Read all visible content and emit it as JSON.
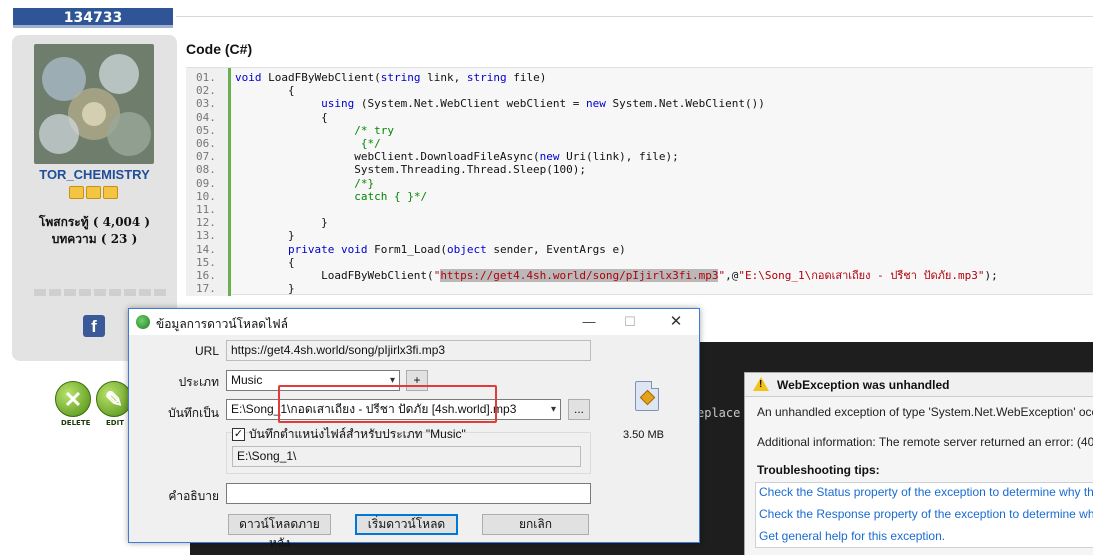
{
  "forum": {
    "post_id": "134733",
    "username": "TOR_CHEMISTRY",
    "posts_label": "โพสกระทู้ ( 4,004 )",
    "articles_label": "บทความ ( 23 )",
    "facebook_glyph": "f",
    "delete_label": "DELETE",
    "edit_label": "EDIT",
    "code_title": "Code (C#)"
  },
  "code": {
    "lines": [
      {
        "n": "01.",
        "parts": [
          {
            "t": "void",
            "c": "kw"
          },
          {
            "t": " LoadFByWebClient("
          },
          {
            "t": "string",
            "c": "kw"
          },
          {
            "t": " link, "
          },
          {
            "t": "string",
            "c": "kw"
          },
          {
            "t": " file)"
          }
        ]
      },
      {
        "n": "02.",
        "parts": [
          {
            "t": "        {"
          }
        ]
      },
      {
        "n": "03.",
        "parts": [
          {
            "t": "             "
          },
          {
            "t": "using",
            "c": "kw"
          },
          {
            "t": " (System.Net.WebClient webClient = "
          },
          {
            "t": "new",
            "c": "kw"
          },
          {
            "t": " System.Net.WebClient())"
          }
        ]
      },
      {
        "n": "04.",
        "parts": [
          {
            "t": "             {"
          }
        ]
      },
      {
        "n": "05.",
        "parts": [
          {
            "t": "                  "
          },
          {
            "t": "/* try",
            "c": "cm"
          }
        ]
      },
      {
        "n": "06.",
        "parts": [
          {
            "t": "                   "
          },
          {
            "t": "{*/",
            "c": "cm"
          }
        ]
      },
      {
        "n": "07.",
        "parts": [
          {
            "t": "                  webClient.DownloadFileAsync("
          },
          {
            "t": "new",
            "c": "kw"
          },
          {
            "t": " Uri(link), file);"
          }
        ]
      },
      {
        "n": "08.",
        "parts": [
          {
            "t": "                  System.Threading.Thread.Sleep(100);"
          }
        ]
      },
      {
        "n": "09.",
        "parts": [
          {
            "t": "                  "
          },
          {
            "t": "/*}",
            "c": "cm"
          }
        ]
      },
      {
        "n": "10.",
        "parts": [
          {
            "t": "                  "
          },
          {
            "t": "catch { }*/",
            "c": "cm"
          }
        ]
      },
      {
        "n": "11.",
        "parts": [
          {
            "t": ""
          }
        ]
      },
      {
        "n": "12.",
        "parts": [
          {
            "t": "             }"
          }
        ]
      },
      {
        "n": "13.",
        "parts": [
          {
            "t": "        }"
          }
        ]
      },
      {
        "n": "14.",
        "parts": [
          {
            "t": "        "
          },
          {
            "t": "private",
            "c": "kw"
          },
          {
            "t": " "
          },
          {
            "t": "void",
            "c": "kw"
          },
          {
            "t": " Form1_Load("
          },
          {
            "t": "object",
            "c": "kw"
          },
          {
            "t": " sender, EventArgs e)"
          }
        ]
      },
      {
        "n": "15.",
        "parts": [
          {
            "t": "        {"
          }
        ]
      },
      {
        "n": "16.",
        "parts": [
          {
            "t": "             LoadFByWebClient("
          },
          {
            "t": "\"",
            "c": "str"
          },
          {
            "t": "https://get4.4sh.world/song/pIjirlx3fi.mp3",
            "c": "str hl"
          },
          {
            "t": "\"",
            "c": "str"
          },
          {
            "t": ",@"
          },
          {
            "t": "\"E:\\Song_1\\กอดเสาเถียง - ปรีชา ปัดภัย.mp3\"",
            "c": "str"
          },
          {
            "t": ");"
          }
        ]
      },
      {
        "n": "17.",
        "parts": [
          {
            "t": "        }"
          }
        ]
      }
    ]
  },
  "vs": {
    "side_word": "eplace",
    "title": "WebException was unhandled",
    "line1": "An unhandled exception of type 'System.Net.WebException' occ",
    "line2": "Additional information: The remote server returned an error: (40",
    "tips_head": "Troubleshooting tips:",
    "link1": "Check the Status property of the exception to determine why th",
    "link2": "Check the Response property of the exception to determine why",
    "link3": "Get general help for this exception."
  },
  "dialog": {
    "title": "ข้อมูลการดาวน์โหลดไฟล์",
    "min_glyph": "—",
    "max_glyph": "☐",
    "close_glyph": "✕",
    "url_label": "URL",
    "url_value": "https://get4.4sh.world/song/pIjirlx3fi.mp3",
    "type_label": "ประเภท",
    "type_value": "Music",
    "add_glyph": "+",
    "save_label": "บันทึกเป็น",
    "save_value": "E:\\Song_1\\กอดเสาเถียง - ปรีชา ปัดภัย [4sh.world].mp3",
    "browse_label": "...",
    "remember_checked": "✓",
    "remember_label": "บันทึกตำแหน่งไฟล์สำหรับประเภท \"Music\"",
    "folder_value": "E:\\Song_1\\",
    "file_size": "3.50  MB",
    "desc_label": "คำอธิบาย",
    "desc_value": "",
    "later_btn": "ดาวน์โหลดภายหลัง",
    "start_btn": "เริ่มดาวน์โหลด",
    "cancel_btn": "ยกเลิก"
  },
  "colors": {
    "highlight_border": "#e23b3b",
    "post_id_bg": "#2f5597",
    "username": "#1f4e9a"
  }
}
